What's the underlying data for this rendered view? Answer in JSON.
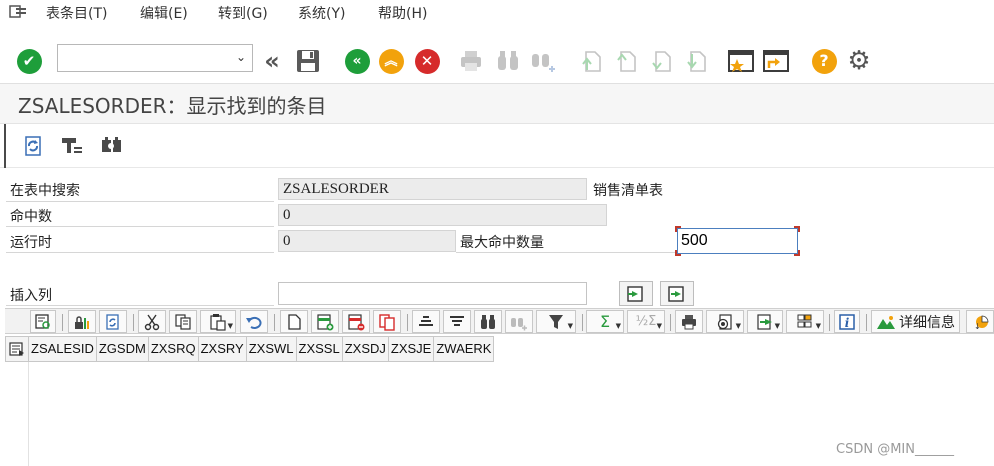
{
  "menubar": {
    "items": [
      "表条目(T)",
      "编辑(E)",
      "转到(G)",
      "系统(Y)",
      "帮助(H)"
    ]
  },
  "toolbar": {
    "command_field_value": ""
  },
  "title": "ZSALESORDER：显示找到的条目",
  "form": {
    "search_table_label": "在表中搜索",
    "search_table_value": "ZSALESORDER",
    "search_table_desc": "销售清单表",
    "hits_label": "命中数",
    "hits_value": "0",
    "runtime_label": "运行时",
    "runtime_value": "0",
    "max_hits_label": "最大命中数量",
    "max_hits_value": "500",
    "insert_col_label": "插入列",
    "insert_col_value": ""
  },
  "alv_toolbar": {
    "details_label": "详细信息"
  },
  "grid": {
    "columns": [
      "ZSALESID",
      "ZGSDM",
      "ZXSRQ",
      "ZXSRY",
      "ZXSWL",
      "ZXSSL",
      "ZXSDJ",
      "ZXSJE",
      "ZWAERK"
    ]
  },
  "watermark": "CSDN @MIN______",
  "colors": {
    "accent_green": "#1e9e3a",
    "accent_orange": "#f2a20c",
    "accent_red": "#d62b2b",
    "focus_blue": "#4c7fbf"
  }
}
